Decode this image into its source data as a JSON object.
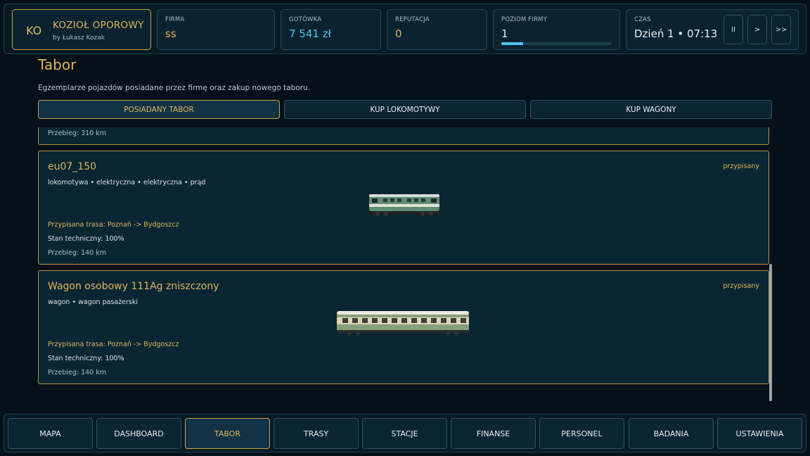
{
  "header": {
    "logo": {
      "abbr": "KO",
      "title": "KOZIOŁ OPOROWY",
      "author": "by Łukasz Kozak"
    },
    "firm": {
      "label": "FIRMA",
      "value": "ss"
    },
    "cash": {
      "label": "GOTÓWKA",
      "value": "7 541 zł"
    },
    "reputation": {
      "label": "REPUTACJA",
      "value": "0"
    },
    "level": {
      "label": "POZIOM FIRMY",
      "value": "1",
      "progress_percent": 20
    },
    "time": {
      "label": "CZAS",
      "value": "Dzień 1 • 07:13"
    },
    "controls": {
      "pause": "II",
      "play": ">",
      "fast": ">>"
    }
  },
  "page": {
    "title": "Tabor",
    "subtitle": "Egzemplarze pojazdów posiadane przez firmę oraz zakup nowego taboru."
  },
  "tabs": [
    {
      "label": "POSIADANY TABOR",
      "active": true
    },
    {
      "label": "KUP LOKOMOTYWY",
      "active": false
    },
    {
      "label": "KUP WAGONY",
      "active": false
    }
  ],
  "cards": [
    {
      "mileage": "Przebieg: 310 km"
    },
    {
      "name": "eu07_150",
      "status": "przypisany",
      "meta": "lokomotywa • elektryczna • elektryczna • prąd",
      "route": "Przypisana trasa: Poznań -> Bydgoszcz",
      "condition": "Stan techniczny: 100%",
      "mileage": "Przebieg: 140 km"
    },
    {
      "name": "Wagon osobowy 111Ag zniszczony",
      "status": "przypisany",
      "meta": "wagon • wagon pasażerski",
      "route": "Przypisana trasa: Poznań -> Bydgoszcz",
      "condition": "Stan techniczny: 100%",
      "mileage": "Przebieg: 140 km"
    }
  ],
  "nav": [
    {
      "label": "MAPA",
      "active": false
    },
    {
      "label": "DASHBOARD",
      "active": false
    },
    {
      "label": "TABOR",
      "active": true
    },
    {
      "label": "TRASY",
      "active": false
    },
    {
      "label": "STACJE",
      "active": false
    },
    {
      "label": "FINANSE",
      "active": false
    },
    {
      "label": "PERSONEL",
      "active": false
    },
    {
      "label": "BADANIA",
      "active": false
    },
    {
      "label": "USTAWIENIA",
      "active": false
    }
  ],
  "colors": {
    "accent": "#e0b45a",
    "cash": "#4fc3f7",
    "background": "#061018"
  }
}
